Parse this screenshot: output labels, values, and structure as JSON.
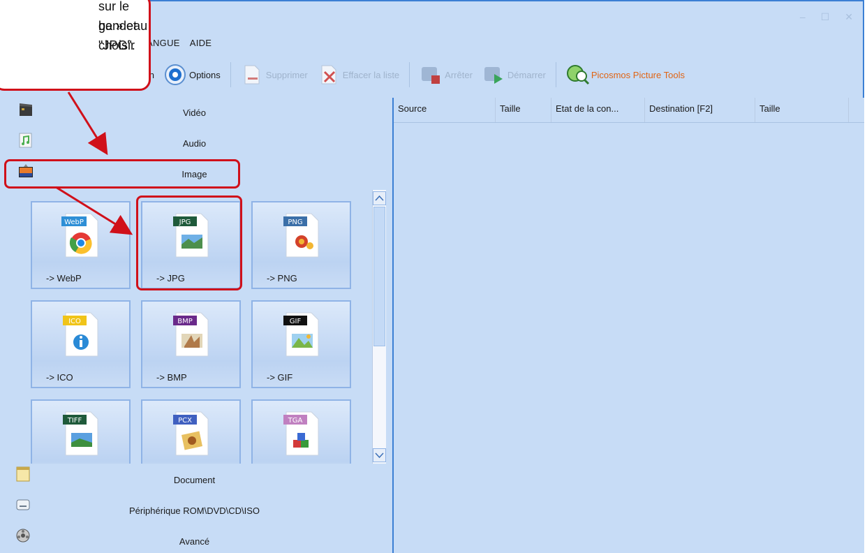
{
  "window": {
    "controls": [
      "–",
      "☐",
      "✕"
    ]
  },
  "menubar": {
    "items": [
      "ANGUE",
      "AIDE"
    ]
  },
  "toolbar": {
    "items": [
      {
        "label": "tion",
        "icon": "orientation-icon",
        "disabled": false
      },
      {
        "label": "Options",
        "icon": "options-icon",
        "disabled": false
      },
      {
        "label": "Supprimer",
        "icon": "delete-icon",
        "disabled": true
      },
      {
        "label": "Effacer la liste",
        "icon": "clear-list-icon",
        "disabled": true
      },
      {
        "label": "Arrêter",
        "icon": "stop-icon",
        "disabled": true
      },
      {
        "label": "Démarrer",
        "icon": "start-icon",
        "disabled": true
      },
      {
        "label": "Picosmos Picture Tools",
        "icon": "picosmos-icon",
        "disabled": false
      }
    ]
  },
  "categories": {
    "top": [
      {
        "label": "Vidéo",
        "icon": "video-icon"
      },
      {
        "label": "Audio",
        "icon": "audio-icon"
      },
      {
        "label": "Image",
        "icon": "image-icon"
      }
    ],
    "bottom": [
      {
        "label": "Document",
        "icon": "document-icon"
      },
      {
        "label": "Périphérique ROM\\DVD\\CD\\ISO",
        "icon": "rom-device-icon"
      },
      {
        "label": "Avancé",
        "icon": "advanced-icon"
      }
    ]
  },
  "tiles": [
    {
      "label": "-> WebP",
      "badge": "WebP",
      "color": "#2e8fd6"
    },
    {
      "label": "-> JPG",
      "badge": "JPG",
      "color": "#1f5a3a"
    },
    {
      "label": "-> PNG",
      "badge": "PNG",
      "color": "#3b6fa8"
    },
    {
      "label": "-> ICO",
      "badge": "ICO",
      "color": "#f0c419"
    },
    {
      "label": "-> BMP",
      "badge": "BMP",
      "color": "#6a2a8a"
    },
    {
      "label": "-> GIF",
      "badge": "GIF",
      "color": "#111111"
    },
    {
      "label": "",
      "badge": "TIFF",
      "color": "#1f5a3a"
    },
    {
      "label": "",
      "badge": "PCX",
      "color": "#4060c0"
    },
    {
      "label": "",
      "badge": "TGA",
      "color": "#c080c0"
    }
  ],
  "table": {
    "columns": [
      "Source",
      "Taille",
      "Etat de la con...",
      "Destination [F2]",
      "Taille"
    ]
  },
  "callout": {
    "lines": [
      "sur le bandeau",
      "ge » et choisir",
      "\"JPG\"."
    ]
  },
  "colors": {
    "accent": "#d0101a",
    "brand": "#e06414",
    "panel": "#c7dcf6"
  }
}
